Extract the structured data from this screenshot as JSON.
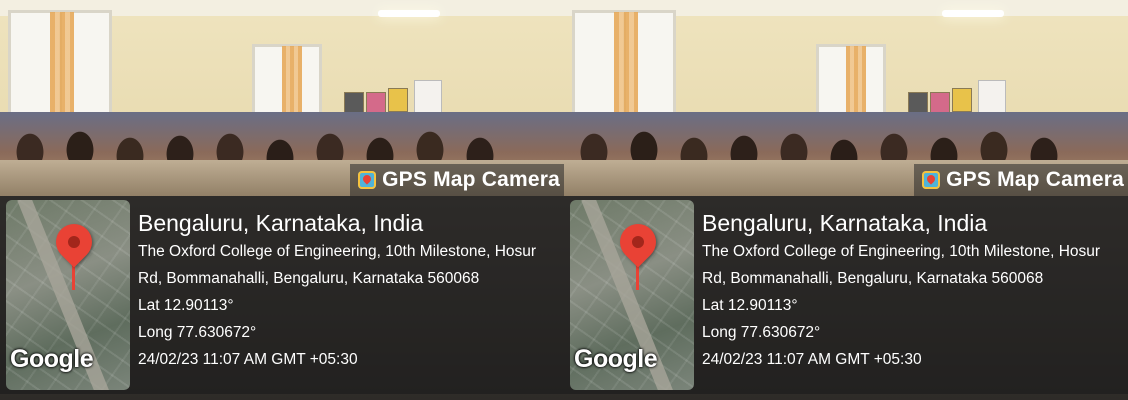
{
  "overlay": {
    "brand": "GPS Map Camera",
    "location_title": "Bengaluru, Karnataka, India",
    "address_line1": "The Oxford College of Engineering, 10th Milestone, Hosur",
    "address_line2": "Rd, Bommanahalli, Bengaluru, Karnataka 560068",
    "lat": "Lat 12.90113°",
    "long": "Long 77.630672°",
    "datetime": "24/02/23 11:07 AM GMT +05:30",
    "map_attribution": "Google"
  },
  "icons": [
    "map-pin-icon",
    "gps-map-camera-icon"
  ],
  "colors": {
    "pin": "#e94235",
    "overlay_bg": "#1c1c1c"
  }
}
